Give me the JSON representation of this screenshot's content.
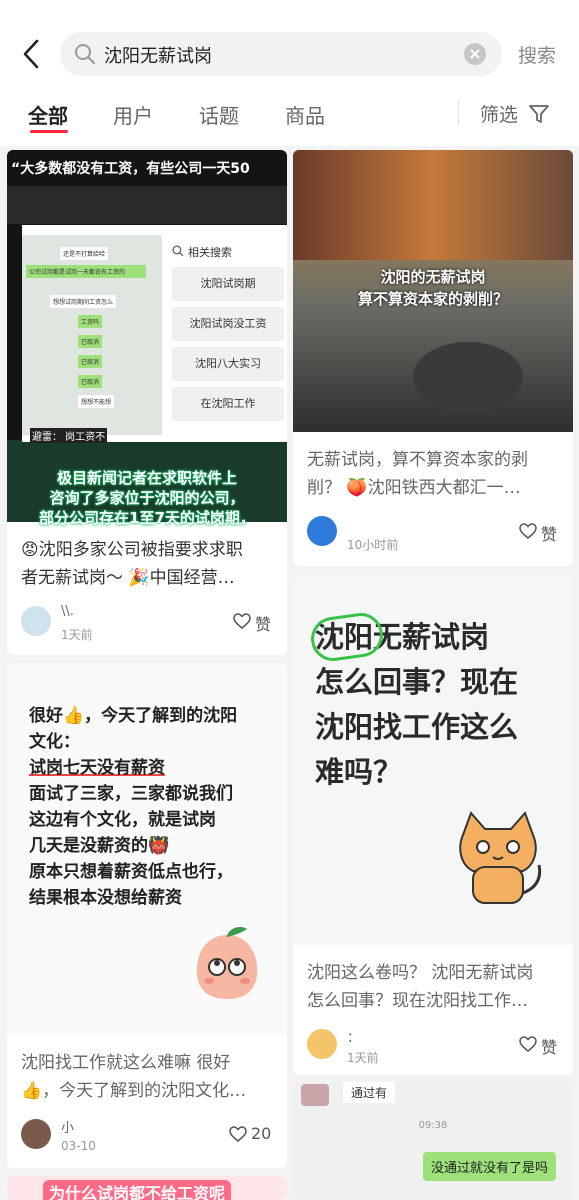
{
  "search": {
    "query": "沈阳无薪试岗",
    "button": "搜索"
  },
  "tabs": [
    "全部",
    "用户",
    "话题",
    "商品"
  ],
  "filter_label": "筛选",
  "cards": [
    {
      "cover_top_text": "“大多数都没有工资，有些公司一天50",
      "overlay_related_label": "相关搜索",
      "overlay_related": [
        "沈阳试岗期",
        "沈阳试岗没工资",
        "沈阳八大实习",
        "在沈阳工作"
      ],
      "overlay_chat": [
        "还是不打算给哈",
        "公司试岗都是试岗一天都说有工资的",
        "想想试岗期间工资怎么",
        "工资吗",
        "已取消",
        "已取消",
        "已取消",
        "想想不能想"
      ],
      "overlay_bottom": "避雷：  岗工资不",
      "cover_caption": [
        "极目新闻记者在求职软件上",
        "咨询了多家位于沈阳的公司，",
        "部分公司存在1至7天的试岗期，"
      ],
      "title": [
        "😡沈阳多家公司被指要求求职",
        "者无薪试岗～ 🎉中国经营…"
      ],
      "user": "\\\\.",
      "time": "1天前",
      "like": "赞"
    },
    {
      "cover_text": [
        "沈阳的无薪试岗",
        "算不算资本家的剥削？"
      ],
      "title": [
        "无薪试岗，算不算资本家的剥",
        "削？ 🍑沈阳铁西大都汇一…"
      ],
      "time": "10小时前",
      "like": "赞"
    },
    {
      "cover_lines": [
        "很好👍，今天了解到的沈阳",
        "文化：",
        "试岗七天没有薪资",
        "面试了三家，三家都说我们",
        "这边有个文化，就是试岗",
        "几天是没薪资的👹",
        "原本只想着薪资低点也行，",
        "结果根本没想给薪资"
      ],
      "title": [
        "沈阳找工作就这么难嘛 很好",
        "👍，今天了解到的沈阳文化…"
      ],
      "user": "小",
      "time": "03-10",
      "like": "20"
    },
    {
      "cover_lines": [
        "沈阳无薪试岗",
        "怎么回事？现在",
        "沈阳找工作这么",
        "难吗？"
      ],
      "title": [
        "沈阳这么卷吗？ 沈阳无薪试岗",
        "怎么回事？现在沈阳找工作…"
      ],
      "user": "：",
      "time": "1天前",
      "like": "赞"
    },
    {
      "cover_text": "为什么试岗都不给工资呢"
    },
    {
      "chat_user_msg": "通过有",
      "chat_time": "09:38",
      "chat_bubble": "没通过就没有了是吗"
    }
  ]
}
